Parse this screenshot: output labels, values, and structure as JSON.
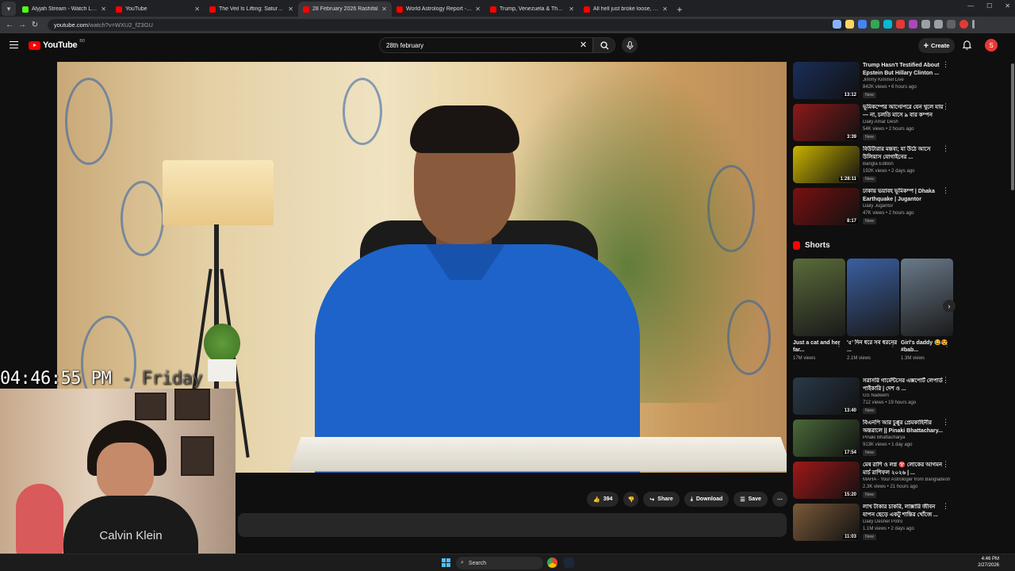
{
  "browser": {
    "tabs": [
      {
        "title": "Alyjah Stream - Watch Live on",
        "favicon_color": "#53fc18",
        "active": false
      },
      {
        "title": "YouTube",
        "favicon_color": "#ff0000",
        "active": false
      },
      {
        "title": "The Veil Is Lifting: Saturn-Nept",
        "favicon_color": "#ff0000",
        "active": false
      },
      {
        "title": "28 February 2026 Rashifal",
        "favicon_color": "#ff0000",
        "active": true
      },
      {
        "title": "World Astrology Report - YouTu",
        "favicon_color": "#ff0000",
        "active": false
      },
      {
        "title": "Trump, Venezuela & The 0\" Ari",
        "favicon_color": "#ff0000",
        "active": false
      },
      {
        "title": "All hell just broke loose, - YouT",
        "favicon_color": "#ff0000",
        "active": false
      }
    ],
    "url_domain": "youtube.com",
    "url_path": "/watch?v=WXU2_fZ3GU"
  },
  "youtube": {
    "logo_text": "YouTube",
    "logo_suffix": "BD",
    "search_value": "28th february",
    "create_label": "Create",
    "avatar_letter": "S"
  },
  "video": {
    "likes": "394",
    "share_label": "Share",
    "download_label": "Download",
    "save_label": "Save"
  },
  "overlay": {
    "clock": "04:46:55 PM",
    "day": " - Friday",
    "shirt_text": "Calvin Klein"
  },
  "sidebar": {
    "recommendations": [
      {
        "title": "Trump Hasn't Testified About Epstein But Hillary Clinton ...",
        "channel": "Jimmy Kimmel Live",
        "meta": "842K views • 6 hours ago",
        "badge": "New",
        "duration": "13:12",
        "thumb": "#1a2e5a"
      },
      {
        "title": "ভূমিকম্পের আগে/পরে যেন খুলে যায়— না, চলতি মাসে ৯ বার কম্পন দেশ...",
        "channel": "Daily Amar Desh",
        "meta": "54K views • 2 hours ago",
        "badge": "New",
        "duration": "3:39",
        "thumb": "#8b1a1a"
      },
      {
        "title": "বিউটারার মন্তব্য; যা উঠে আসে উলিয়াস যোগাইনের ...",
        "channel": "Bangla Edition",
        "meta": "192K views • 2 days ago",
        "badge": "New",
        "duration": "1:28:11",
        "thumb": "#c9b300"
      },
      {
        "title": "ঢাকায় ভয়াবহ ভূমিকম্প | Dhaka Earthquake | Jugantor",
        "channel": "Daily Jugantor",
        "meta": "47K views • 2 hours ago",
        "badge": "New",
        "duration": "8:17",
        "thumb": "#7a1010"
      }
    ],
    "shorts_title": "Shorts",
    "shorts": [
      {
        "title": "Just a cat and her far...",
        "views": "17M views",
        "thumb": "#5a6b3a"
      },
      {
        "title": "'৫' দিন ধরে সব ধরনের ...",
        "views": "2.1M views",
        "thumb": "#3a5fa0"
      },
      {
        "title": "Girl's daddy 😂😍 #bab...",
        "views": "1.3M views",
        "thumb": "#6a7a8a"
      }
    ],
    "recommendations2": [
      {
        "title": "সরাসরি গার্মেন্টসের এক্সপোর্ট লেপার্ড পাইকারি | দেশ ও ...",
        "channel": "GS Nadeem",
        "meta": "712 views • 19 hours ago",
        "badge": "New",
        "duration": "13:40",
        "thumb": "#2a3a4a"
      },
      {
        "title": "বিএনপি আর চুপ্পুর প্রেমকাহিনীর অন্তরালে || Pinaki Bhattachary...",
        "channel": "Pinaki Bhattacharya",
        "meta": "913K views • 1 day ago",
        "badge": "New",
        "duration": "17:54",
        "thumb": "#4a6a3a"
      },
      {
        "title": "মেষ রাশি ও লগ্ন ♈ লোকের আগমন মার্চ রাশিফল ২০২৬ | ...",
        "channel": "MAHA - Your Astrologer from Bangladesh",
        "meta": "2.3K views • 21 hours ago",
        "badge": "New",
        "duration": "15:20",
        "thumb": "#a01818"
      },
      {
        "title": "লাখ টাকার চাকরি, লাক্সারি জীবন যাপন ছেড়ে একটু শান্তির খোঁজে ...",
        "channel": "Daily Desher Potro",
        "meta": "1.1M views • 2 days ago",
        "badge": "New",
        "duration": "11:03",
        "thumb": "#7a5a3a"
      }
    ]
  },
  "taskbar": {
    "search_label": "Search",
    "time": "4:46 PM",
    "date": "2/27/2026"
  }
}
